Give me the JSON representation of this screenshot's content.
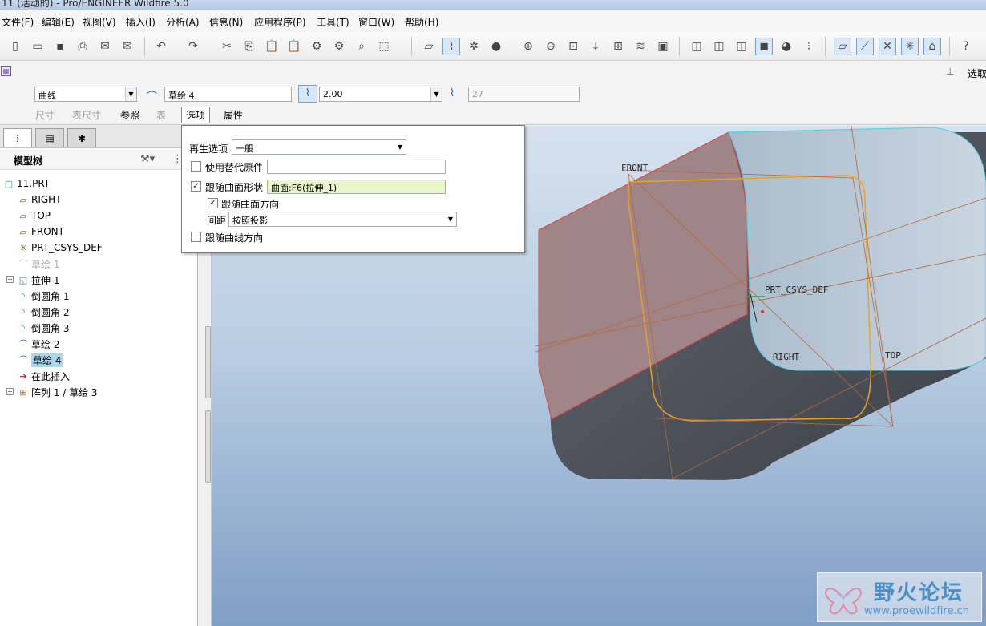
{
  "window": {
    "title": "11 (活动的) - Pro/ENGINEER Wildfire 5.0"
  },
  "menu": [
    "文件(F)",
    "编辑(E)",
    "视图(V)",
    "插入(I)",
    "分析(A)",
    "信息(N)",
    "应用程序(P)",
    "工具(T)",
    "窗口(W)",
    "帮助(H)"
  ],
  "top_right": {
    "label": "选取"
  },
  "dashboard": {
    "type_combo": "曲线",
    "sketch_field": "草绘 4",
    "value_combo": "2.00",
    "count_field": "27",
    "tabs": [
      "尺寸",
      "表尺寸",
      "参照",
      "表",
      "选项",
      "属性"
    ],
    "active_tab": "选项"
  },
  "options_panel": {
    "regen_label": "再生选项",
    "regen_value": "一般",
    "use_alt_label": "使用替代原件",
    "follow_surface_shape_label": "跟随曲面形状",
    "follow_surface_shape_value": "曲面:F6(拉伸_1)",
    "follow_surface_dir_label": "跟随曲面方向",
    "spacing_label": "间距",
    "spacing_value": "按照投影",
    "follow_curve_dir_label": "跟随曲线方向"
  },
  "model_tree": {
    "header": "模型树",
    "nodes": [
      {
        "label": "11.PRT",
        "icon": "part-icon",
        "state": "normal"
      },
      {
        "label": "RIGHT",
        "icon": "datum-plane-icon",
        "state": "normal"
      },
      {
        "label": "TOP",
        "icon": "datum-plane-icon",
        "state": "normal"
      },
      {
        "label": "FRONT",
        "icon": "datum-plane-icon",
        "state": "normal"
      },
      {
        "label": "PRT_CSYS_DEF",
        "icon": "csys-icon",
        "state": "normal"
      },
      {
        "label": "草绘 1",
        "icon": "sketch-icon",
        "state": "dimmed"
      },
      {
        "label": "拉伸 1",
        "icon": "extrude-icon",
        "state": "normal"
      },
      {
        "label": "倒圆角 1",
        "icon": "round-icon",
        "state": "normal"
      },
      {
        "label": "倒圆角 2",
        "icon": "round-icon",
        "state": "normal"
      },
      {
        "label": "倒圆角 3",
        "icon": "round-icon",
        "state": "normal"
      },
      {
        "label": "草绘 2",
        "icon": "sketch-icon",
        "state": "normal"
      },
      {
        "label": "草绘 4",
        "icon": "sketch-icon",
        "state": "selected"
      },
      {
        "label": "在此插入",
        "icon": "insert-arrow-icon",
        "state": "normal"
      },
      {
        "label": "阵列 1 / 草绘 3",
        "icon": "pattern-icon",
        "state": "normal"
      }
    ]
  },
  "viewport": {
    "datum_labels": [
      "FRONT",
      "PRT_CSYS_DEF",
      "RIGHT",
      "TOP"
    ]
  },
  "watermark": {
    "title": "野火论坛",
    "url": "www.proewildfire.cn"
  }
}
